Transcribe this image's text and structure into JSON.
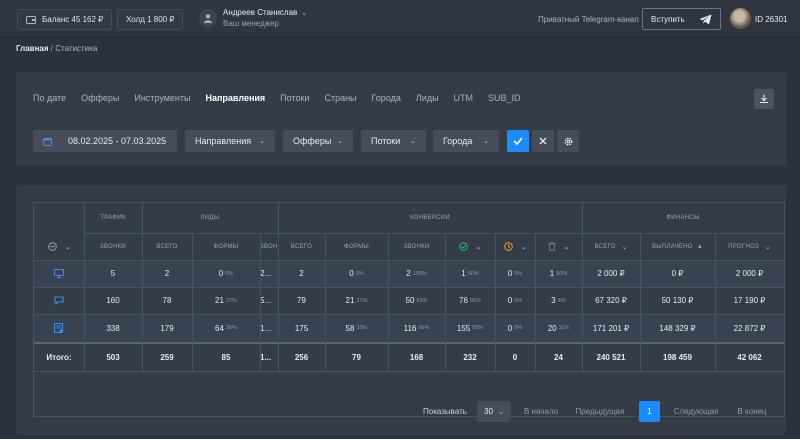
{
  "topbar": {
    "balance": "Баланс 45 162 ₽",
    "hold": "Холд 1 800 ₽",
    "manager_name": "Андреев Станислав",
    "manager_role": "Ваш менеджер",
    "telegram_text": "Приватный Telegram-канал",
    "join_label": "Вступить",
    "user_id": "ID 26301"
  },
  "breadcrumb": {
    "home": "Главная",
    "separator": "/",
    "current": "Статистика"
  },
  "tabs": [
    "По дате",
    "Офферы",
    "Инструменты",
    "Направления",
    "Потоки",
    "Страны",
    "Города",
    "Лиды",
    "UTM",
    "SUB_ID"
  ],
  "active_tab": "Направления",
  "filters": {
    "date_range": "08.02.2025 - 07.03.2025",
    "directions": "Направления",
    "offers": "Офферы",
    "streams": "Потоки",
    "cities": "Города"
  },
  "table": {
    "groups": {
      "traffic": "ТРАФИК",
      "leads": "ЛИДЫ",
      "conversions": "КОНВЕРСИИ",
      "finance": "ФИНАНСЫ"
    },
    "columns": {
      "calls": "ЗВОНКИ",
      "leads_total": "ВСЕГО",
      "leads_forms": "ФОРМЫ",
      "leads_calls": "ЗВОН",
      "conv_total": "ВСЕГО",
      "conv_forms": "ФОРМЫ",
      "conv_calls": "ЗВОНКИ",
      "fin_total": "ВСЕГО",
      "fin_paid": "ВЫПЛАЧЕНО",
      "fin_paid_sort": "▲",
      "fin_forecast": "ПРОГНОЗ"
    },
    "rows": [
      {
        "icon": "monitor-icon",
        "calls": "5",
        "leads_total": "2",
        "leads_forms": "0",
        "leads_forms_pct": "0%",
        "leads_calls": "2...",
        "conv_total": "2",
        "conv_forms": "0",
        "conv_forms_pct": "0%",
        "conv_calls": "2",
        "conv_calls_pct": "100%",
        "approved": "1",
        "approved_pct": "50%",
        "pending": "0",
        "pending_pct": "0%",
        "rejected": "1",
        "rejected_pct": "50%",
        "fin_total": "2 000 ₽",
        "fin_paid": "0 ₽",
        "fin_forecast": "2 000 ₽"
      },
      {
        "icon": "chat-icon",
        "calls": "160",
        "leads_total": "78",
        "leads_forms": "21",
        "leads_forms_pct": "27%",
        "leads_calls": "5...",
        "conv_total": "79",
        "conv_forms": "21",
        "conv_forms_pct": "27%",
        "conv_calls": "50",
        "conv_calls_pct": "63%",
        "approved": "76",
        "approved_pct": "96%",
        "pending": "0",
        "pending_pct": "0%",
        "rejected": "3",
        "rejected_pct": "4%",
        "fin_total": "67 320 ₽",
        "fin_paid": "50 130 ₽",
        "fin_forecast": "17 190 ₽"
      },
      {
        "icon": "form-icon",
        "calls": "338",
        "leads_total": "179",
        "leads_forms": "64",
        "leads_forms_pct": "36%",
        "leads_calls": "1...",
        "conv_total": "175",
        "conv_forms": "58",
        "conv_forms_pct": "33%",
        "conv_calls": "116",
        "conv_calls_pct": "66%",
        "approved": "155",
        "approved_pct": "89%",
        "pending": "0",
        "pending_pct": "0%",
        "rejected": "20",
        "rejected_pct": "11%",
        "fin_total": "171 201 ₽",
        "fin_paid": "148 329 ₽",
        "fin_forecast": "22 872 ₽"
      }
    ],
    "total": {
      "label": "Итого:",
      "calls": "503",
      "leads_total": "259",
      "leads_forms": "85",
      "leads_calls": "1...",
      "conv_total": "256",
      "conv_forms": "79",
      "conv_calls": "168",
      "approved": "232",
      "pending": "0",
      "rejected": "24",
      "fin_total": "240 521",
      "fin_paid": "198 459",
      "fin_forecast": "42 062"
    }
  },
  "pagination": {
    "show_label": "Показывать",
    "page_size": "30",
    "first": "В начало",
    "prev": "Предыдущая",
    "current_page": "1",
    "next": "Следующая",
    "last": "В конец"
  },
  "colors": {
    "accent": "#1a8cff",
    "approved": "#27c26a",
    "pending": "#f0a020",
    "icon_blue": "#3d8ee8"
  }
}
